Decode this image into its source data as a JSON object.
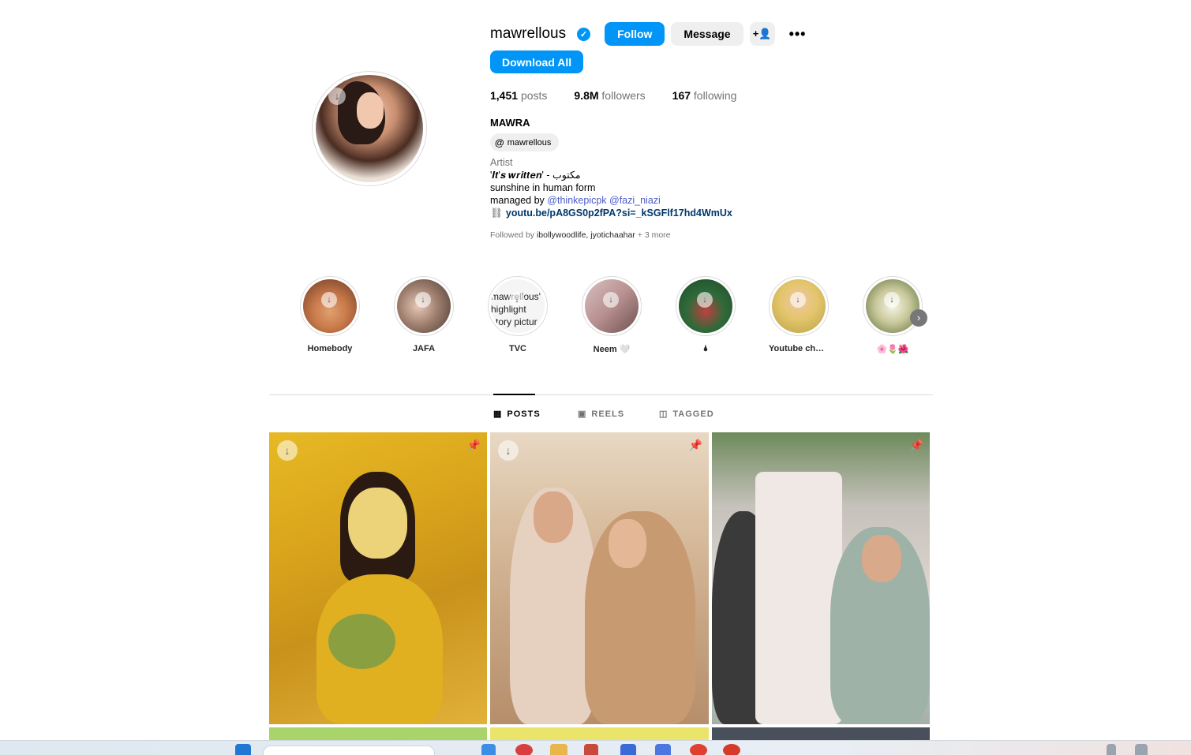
{
  "profile": {
    "username": "mawrellous",
    "follow_label": "Follow",
    "message_label": "Message",
    "download_all_label": "Download All",
    "posts_count": "1,451",
    "posts_label": "posts",
    "followers_count": "9.8M",
    "followers_label": "followers",
    "following_count": "167",
    "following_label": "following",
    "full_name": "MAWRA",
    "threads_handle": "mawrellous",
    "category": "Artist",
    "bio_line1": "'𝑰𝒕'𝒔 𝒘𝒓𝒊𝒕𝒕𝒆𝒏' - مکتوب",
    "bio_line2": "sunshine in human form",
    "bio_managed_by": "managed by",
    "mention1": "@thinkepicpk",
    "mention2": "@fazi_niazi",
    "link": "youtu.be/pA8GS0p2fPA?si=_kSGFlf17hd4WmUx",
    "followed_by_prefix": "Followed by",
    "followed_by_users": "ibollywoodlife, jyotichaahar",
    "followed_by_more": "+ 3 more"
  },
  "highlights": [
    {
      "label": "Homebody",
      "color": "#c97a4a"
    },
    {
      "label": "JAFA",
      "color": "#a08070"
    },
    {
      "label": "TVC",
      "text": "mawrellous' highlight story pictur"
    },
    {
      "label": "Neem 🤍",
      "color": "#b89090"
    },
    {
      "label": "🌢",
      "color": "#2f6a3a"
    },
    {
      "label": "Youtube chan...",
      "color": "#e3c56a"
    },
    {
      "label": "🌸🌷🌺",
      "color": "#c8c89a"
    }
  ],
  "tabs": [
    {
      "label": "POSTS",
      "icon": "grid-icon"
    },
    {
      "label": "REELS",
      "icon": "reels-icon"
    },
    {
      "label": "TAGGED",
      "icon": "tagged-icon"
    }
  ],
  "colors": {
    "accent": "#0095f6",
    "secondary_button": "#efefef",
    "muted_text": "#737373"
  }
}
